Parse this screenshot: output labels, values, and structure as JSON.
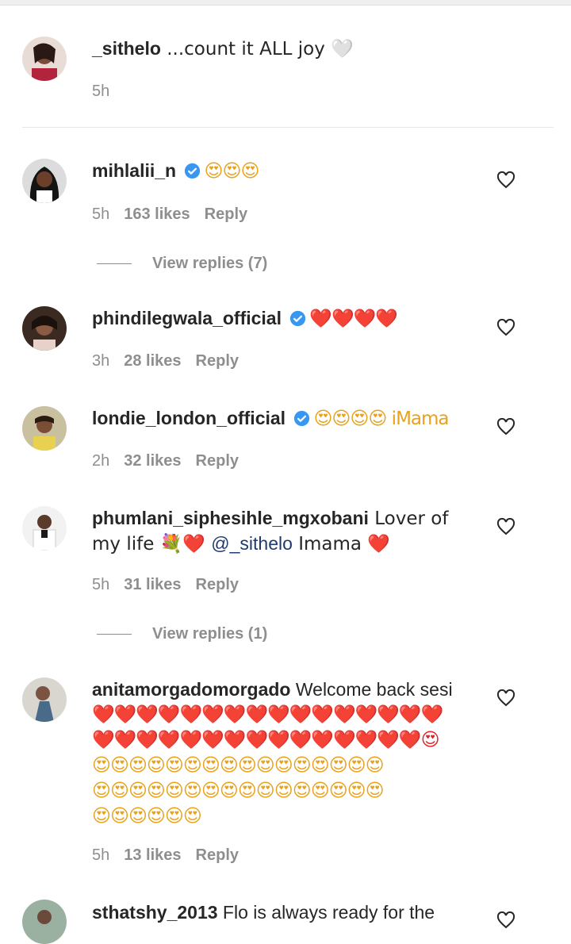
{
  "comments": [
    {
      "user": "_sithelo",
      "verified": false,
      "text": " ...count it ALL joy 🤍",
      "time": "5h",
      "likes": "",
      "reply": "",
      "has_heart": false
    },
    {
      "user": "mihlalii_n",
      "verified": true,
      "text": "😍😍😍",
      "time": "5h",
      "likes": "163 likes",
      "reply": "Reply",
      "has_heart": true,
      "view_replies": "View replies (7)"
    },
    {
      "user": "phindilegwala_official",
      "verified": true,
      "text": "❤️❤️❤️❤️",
      "time": "3h",
      "likes": "28 likes",
      "reply": "Reply",
      "has_heart": true
    },
    {
      "user": "londie_london_official",
      "verified": true,
      "text": "😍😍😍😍 iMama",
      "time": "2h",
      "likes": "32 likes",
      "reply": "Reply",
      "has_heart": true
    },
    {
      "user": "phumlani_siphesihle_mgxobani",
      "verified": false,
      "text_before": " Lover of my life 💐❤️ ",
      "mention": "@_sithelo",
      "text_after": " Imama ❤️",
      "time": "5h",
      "likes": "31 likes",
      "reply": "Reply",
      "has_heart": true,
      "view_replies": "View replies (1)"
    },
    {
      "user": "anitamorgadomorgado",
      "verified": false,
      "text": " Welcome back sesi",
      "hearts_line1": "❤️❤️❤️❤️❤️❤️❤️❤️❤️❤️❤️❤️❤️❤️❤️❤️",
      "hearts_line2": "❤️❤️❤️❤️❤️❤️❤️❤️❤️❤️❤️❤️❤️❤️❤️😍",
      "faces_line3": "😍😍😍😍😍😍😍😍😍😍😍😍😍😍😍😍",
      "faces_line4": "😍😍😍😍😍😍😍😍😍😍😍😍😍😍😍😍",
      "faces_line5": "😍😍😍😍😍😍",
      "time": "5h",
      "likes": "13 likes",
      "reply": "Reply",
      "has_heart": true
    },
    {
      "user": "sthatshy_2013",
      "verified": false,
      "text": " Flo is always ready for the",
      "has_heart": true
    }
  ],
  "icons": {
    "verified": "verified-badge-icon",
    "heart": "heart-outline-icon"
  },
  "colors": {
    "verified": "#3897f0",
    "muted": "#8e8e8e",
    "mention": "#1f3a6e"
  }
}
